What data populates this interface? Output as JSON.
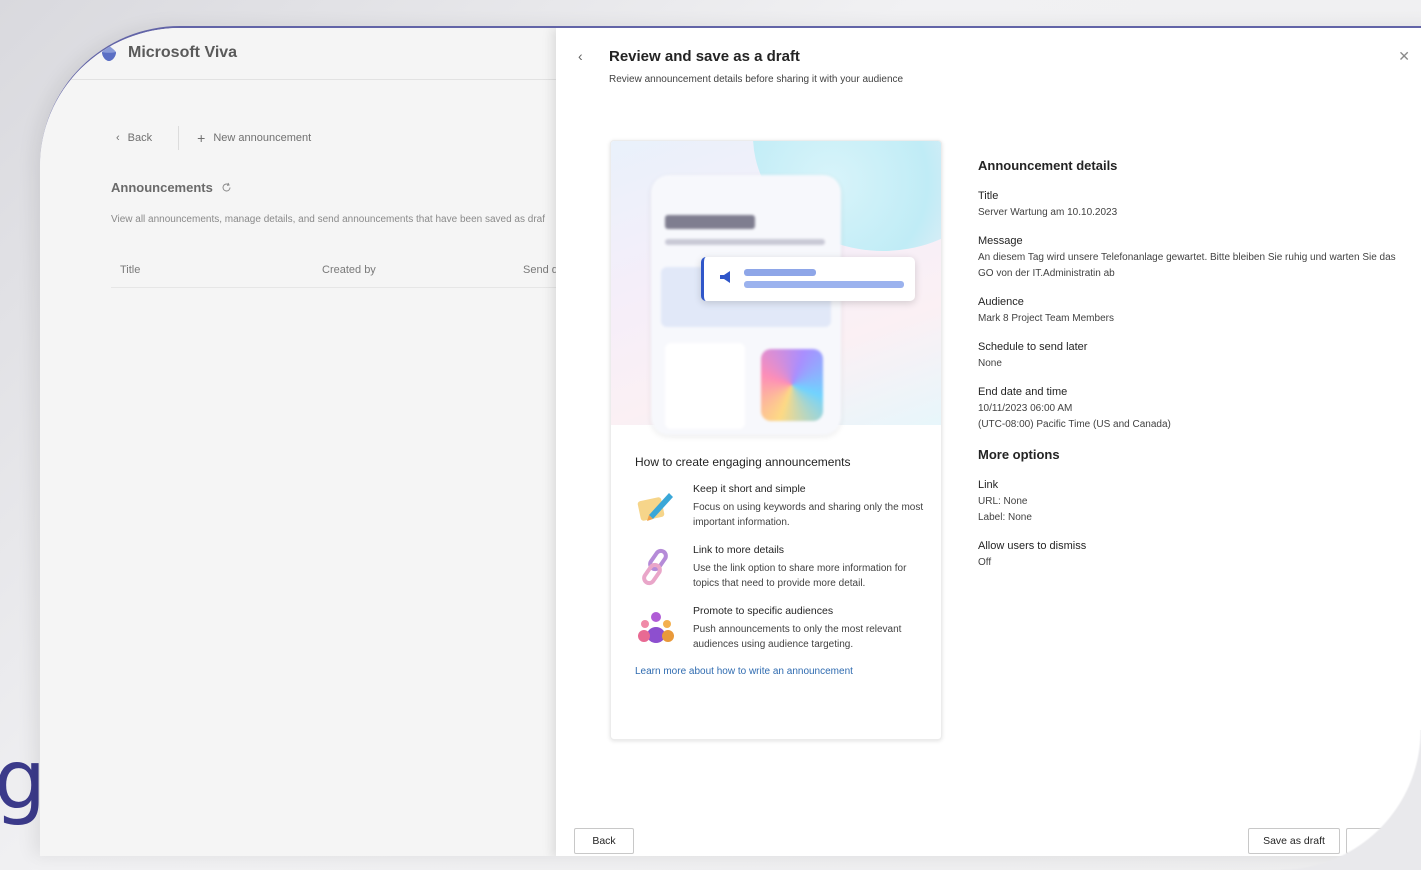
{
  "background": {
    "decor_letter": "g"
  },
  "app": {
    "name": "Microsoft Viva"
  },
  "left": {
    "back_label": "Back",
    "new_announcement_label": "New announcement",
    "section_title": "Announcements",
    "description": "View all announcements, manage details, and send announcements that have been saved as draf",
    "columns": [
      "Title",
      "Created by",
      "Send d"
    ]
  },
  "panel": {
    "title": "Review and save as a draft",
    "subtitle": "Review announcement details before sharing it with your audience",
    "back_chevron": "‹",
    "close_glyph": "✕",
    "tips": {
      "heading": "How to create engaging announcements",
      "items": [
        {
          "title": "Keep it short and simple",
          "desc": "Focus on using keywords and sharing only the most important information.",
          "icon": "pencil-note-icon"
        },
        {
          "title": "Link to more details",
          "desc": "Use the link option to share more information for topics that need to provide more detail.",
          "icon": "link-icon"
        },
        {
          "title": "Promote to specific audiences",
          "desc": "Push announcements to only the most relevant audiences using audience targeting.",
          "icon": "people-group-icon"
        }
      ],
      "link": "Learn more about how to write an announcement"
    },
    "details": {
      "heading": "Announcement details",
      "title_label": "Title",
      "title_value": "Server Wartung am 10.10.2023",
      "message_label": "Message",
      "message_value": "An diesem Tag wird unsere Telefonanlage gewartet. Bitte bleiben Sie ruhig und warten Sie das GO von der IT.Administratin ab",
      "audience_label": "Audience",
      "audience_value": "Mark 8 Project Team Members",
      "schedule_label": "Schedule to send later",
      "schedule_value": "None",
      "end_label": "End date and time",
      "end_value": "10/11/2023 06:00 AM",
      "end_tz": "(UTC-08:00) Pacific Time (US and Canada)"
    },
    "more": {
      "heading": "More options",
      "link_label": "Link",
      "url_value": "URL: None",
      "label_value": "Label: None",
      "dismiss_label": "Allow users to dismiss",
      "dismiss_value": "Off"
    },
    "footer": {
      "back": "Back",
      "save_draft": "Save as draft"
    }
  },
  "colors": {
    "accent": "#6264a7",
    "link": "#2f6bb0",
    "hero_blue": "#2f56c9"
  }
}
